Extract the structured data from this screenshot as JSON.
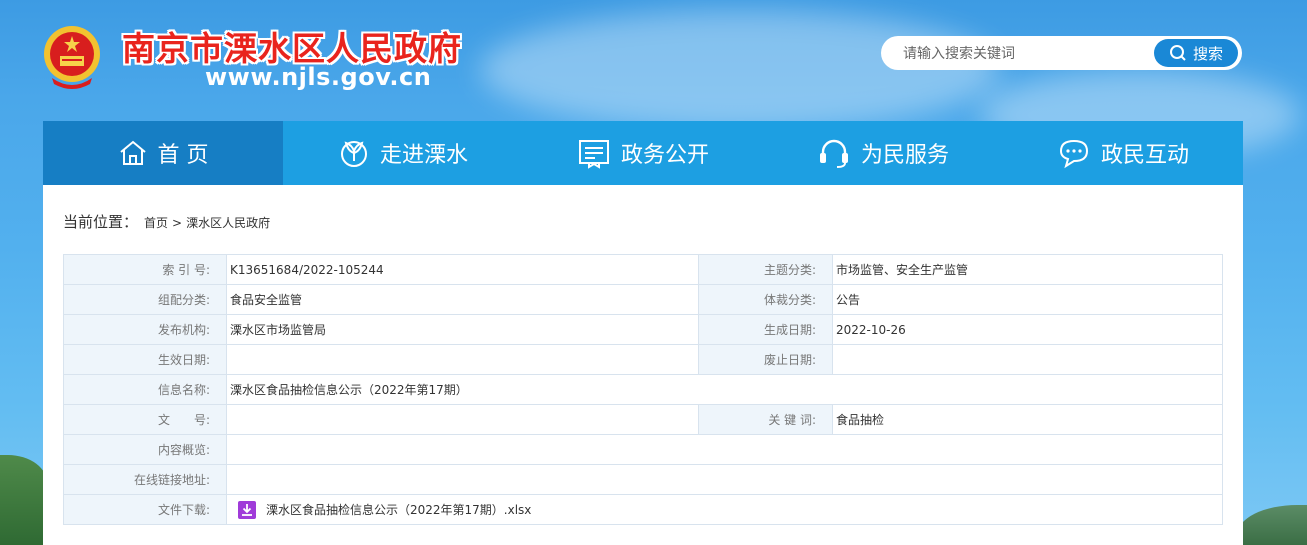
{
  "header": {
    "site_name": "南京市溧水区人民政府",
    "site_url": "www.njls.gov.cn"
  },
  "search": {
    "placeholder": "请输入搜索关键词",
    "button_label": "搜索"
  },
  "nav": {
    "items": [
      {
        "label": "首 页",
        "icon": "home-icon",
        "active": true
      },
      {
        "label": "走进溧水",
        "icon": "leaf-icon",
        "active": false
      },
      {
        "label": "政务公开",
        "icon": "document-icon",
        "active": false
      },
      {
        "label": "为民服务",
        "icon": "headset-icon",
        "active": false
      },
      {
        "label": "政民互动",
        "icon": "chat-icon",
        "active": false
      }
    ]
  },
  "breadcrumb": {
    "label": "当前位置：",
    "items": [
      "首页",
      "溧水区人民政府"
    ],
    "separator": ">"
  },
  "meta": {
    "index_no": {
      "key": "索 引 号:",
      "value": "K13651684/2022-105244"
    },
    "topic": {
      "key": "主题分类:",
      "value": "市场监管、安全生产监管"
    },
    "category": {
      "key": "组配分类:",
      "value": "食品安全监管"
    },
    "genre": {
      "key": "体裁分类:",
      "value": "公告"
    },
    "publisher": {
      "key": "发布机构:",
      "value": "溧水区市场监管局"
    },
    "created": {
      "key": "生成日期:",
      "value": "2022-10-26"
    },
    "effective": {
      "key": "生效日期:",
      "value": ""
    },
    "expired": {
      "key": "废止日期:",
      "value": ""
    },
    "info_name": {
      "key": "信息名称:",
      "value": "溧水区食品抽检信息公示（2022年第17期）"
    },
    "doc_no": {
      "key": "文　　号:",
      "value": ""
    },
    "keywords": {
      "key": "关 键 词:",
      "value": "食品抽检"
    },
    "summary": {
      "key": "内容概览:",
      "value": ""
    },
    "online_link": {
      "key": "在线链接地址:",
      "value": ""
    },
    "download": {
      "key": "文件下载:",
      "value": "溧水区食品抽检信息公示（2022年第17期）.xlsx"
    }
  },
  "colors": {
    "nav_bg": "#1d9fe2",
    "nav_active": "#167ec4",
    "title_red": "#e9241d",
    "search_btn": "#1a88d6",
    "download_icon": "#a03bd9"
  }
}
